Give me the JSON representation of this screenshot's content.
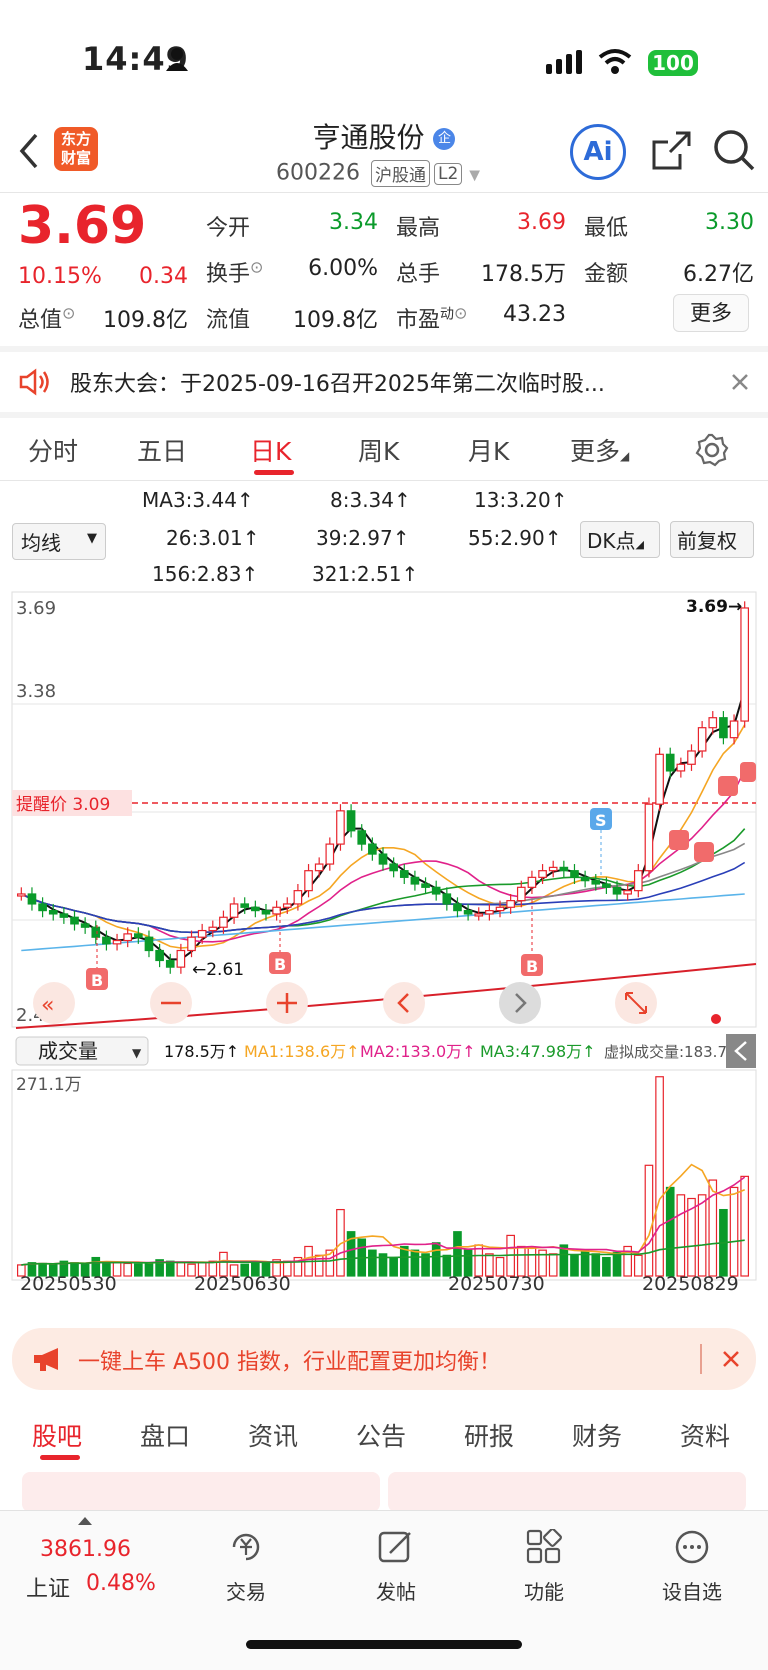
{
  "status": {
    "time": "14:49",
    "battery": "100"
  },
  "header": {
    "logo": "东方\n财富",
    "name": "亨通股份",
    "name_badge": "企",
    "code": "600226",
    "tag1": "沪股通",
    "tag2": "L2",
    "ai": "Ai"
  },
  "quote": {
    "price": "3.69",
    "pct": "10.15%",
    "change": "0.34",
    "open_label": "今开",
    "open": "3.34",
    "high_label": "最高",
    "high": "3.69",
    "low_label": "最低",
    "low": "3.30",
    "turnover_label": "换手",
    "turnover": "6.00%",
    "volume_label": "总手",
    "volume": "178.5万",
    "amount_label": "金额",
    "amount": "6.27亿",
    "mktcap_label": "总值",
    "mktcap": "109.8亿",
    "float_label": "流值",
    "float": "109.8亿",
    "pe_label": "市盈",
    "pe_sup": "动",
    "pe": "43.23",
    "more": "更多"
  },
  "notice": {
    "text": "股东大会：于2025-09-16召开2025年第二次临时股..."
  },
  "tabs": [
    "分时",
    "五日",
    "日K",
    "周K",
    "月K",
    "更多"
  ],
  "ma_panel": {
    "select": "均线",
    "items": [
      {
        "text": "MA3:3.44↑",
        "color": "#111111"
      },
      {
        "text": "8:3.34↑",
        "color": "#f5a623"
      },
      {
        "text": "13:3.20↑",
        "color": "#e0218a"
      },
      {
        "text": "26:3.01↑",
        "color": "#1a9a2a"
      },
      {
        "text": "39:2.97↑",
        "color": "#888888"
      },
      {
        "text": "55:2.90↑",
        "color": "#2a3fb8"
      },
      {
        "text": "156:2.83↑",
        "color": "#5ab4ea"
      },
      {
        "text": "321:2.51↑",
        "color": "#d8202a"
      }
    ],
    "dk": "DK点",
    "adjust": "前复权"
  },
  "chart_data": {
    "type": "candlestick",
    "price_axis": {
      "max": "3.69",
      "level2": "3.38",
      "min": "2.43"
    },
    "alert": {
      "label": "提醒价 3.09",
      "value": 3.09
    },
    "high_marker": "3.69→",
    "low_marker": "←2.61",
    "buy_mark": "B",
    "sell_mark": "S",
    "volume": {
      "select": "成交量",
      "current": "178.5万↑",
      "ma1": "MA1:138.6万↑",
      "ma2": "MA2:133.0万↑",
      "ma3": "MA3:47.98万↑",
      "virtual": "虚拟成交量:183.7万",
      "max_label": "271.1万"
    },
    "dates": [
      "20250530",
      "20250630",
      "20250730",
      "20250829"
    ],
    "closes": [
      2.83,
      2.8,
      2.78,
      2.77,
      2.76,
      2.74,
      2.73,
      2.7,
      2.68,
      2.69,
      2.71,
      2.7,
      2.66,
      2.63,
      2.61,
      2.66,
      2.7,
      2.72,
      2.73,
      2.76,
      2.8,
      2.79,
      2.78,
      2.77,
      2.79,
      2.8,
      2.84,
      2.9,
      2.92,
      2.98,
      3.08,
      3.02,
      2.98,
      2.95,
      2.92,
      2.9,
      2.88,
      2.86,
      2.85,
      2.83,
      2.8,
      2.78,
      2.77,
      2.77,
      2.78,
      2.79,
      2.81,
      2.85,
      2.88,
      2.9,
      2.91,
      2.9,
      2.88,
      2.87,
      2.86,
      2.85,
      2.83,
      2.84,
      2.9,
      3.1,
      3.25,
      3.2,
      3.22,
      3.26,
      3.33,
      3.36,
      3.3,
      3.35,
      3.69
    ],
    "volumes": [
      15,
      18,
      17,
      16,
      20,
      18,
      16,
      25,
      19,
      18,
      17,
      16,
      18,
      22,
      20,
      18,
      16,
      18,
      20,
      32,
      15,
      16,
      18,
      17,
      22,
      20,
      25,
      40,
      28,
      35,
      90,
      60,
      50,
      35,
      30,
      25,
      40,
      35,
      30,
      45,
      28,
      60,
      35,
      42,
      30,
      25,
      55,
      40,
      38,
      35,
      30,
      42,
      28,
      35,
      30,
      25,
      32,
      40,
      28,
      150,
      270,
      120,
      110,
      105,
      110,
      130,
      90,
      120,
      135
    ]
  },
  "banner": {
    "text": "一键上车 A500 指数，行业配置更加均衡！"
  },
  "bottom_tabs": [
    "股吧",
    "盘口",
    "资讯",
    "公告",
    "研报",
    "财务",
    "资料"
  ],
  "bottom_nav": {
    "index_value": "3861.96",
    "index_name": "上证",
    "index_pct": "0.48%",
    "items": [
      "交易",
      "发帖",
      "功能",
      "设自选"
    ]
  }
}
